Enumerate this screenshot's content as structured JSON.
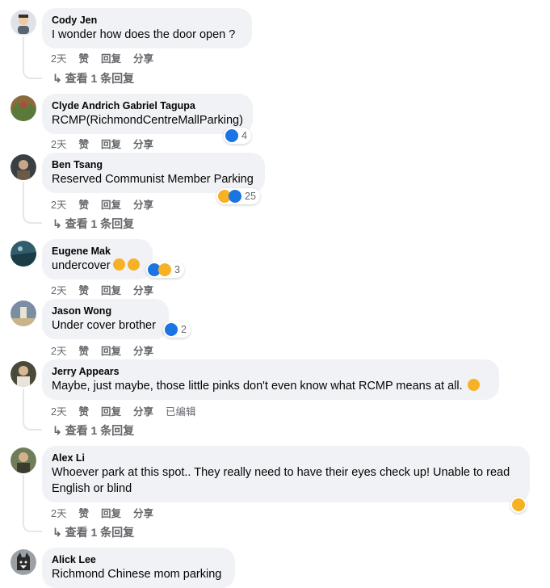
{
  "labels": {
    "like": "赞",
    "reply": "回复",
    "share": "分享",
    "edited": "已编辑"
  },
  "comments": [
    {
      "author": "Cody Jen",
      "text": "I wonder how does the door open ?",
      "time": "2天",
      "view_replies": "↳ 查看 1 条回复"
    },
    {
      "author": "Clyde Andrich Gabriel Tagupa",
      "text": "RCMP(RichmondCentreMallParking)",
      "time": "2天",
      "reaction_count": "4"
    },
    {
      "author": "Ben Tsang",
      "text": "Reserved Communist Member Parking",
      "time": "2天",
      "reaction_count": "25",
      "view_replies": "↳ 查看 1 条回复"
    },
    {
      "author": "Eugene Mak",
      "text": "undercover",
      "time": "2天",
      "reaction_count": "3"
    },
    {
      "author": "Jason Wong",
      "text": "Under cover brother",
      "time": "2天",
      "reaction_count": "2"
    },
    {
      "author": "Jerry Appears",
      "text": "Maybe, just maybe, those little pinks don't even know what RCMP means at all.",
      "time": "2天",
      "view_replies": "↳ 查看 1 条回复"
    },
    {
      "author": "Alex Li",
      "text_line1": "Whoever park at this spot.. They really need to have their eyes check up! Unable to read",
      "text_line2": "English or blind",
      "time": "2天",
      "view_replies": "↳ 查看 1 条回复"
    },
    {
      "author": "Alick Lee",
      "text": "Richmond Chinese mom parking"
    }
  ],
  "colors": {
    "bubble": "#f0f2f5",
    "secondary_text": "#65676b",
    "like_blue": "#1b74e4",
    "haha_yellow": "#f7b125"
  }
}
